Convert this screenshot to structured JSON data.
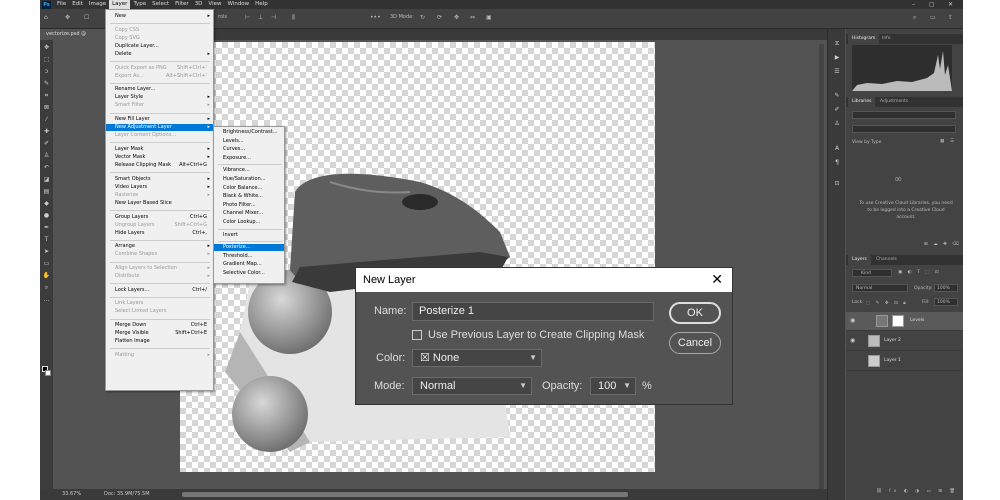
{
  "menubar": {
    "app_icon": "Ps",
    "items": [
      "File",
      "Edit",
      "Image",
      "Layer",
      "Type",
      "Select",
      "Filter",
      "3D",
      "View",
      "Window",
      "Help"
    ],
    "active": "Layer",
    "window_controls": [
      "–",
      "▢",
      "✕"
    ]
  },
  "optionsbar": {
    "transform_label": "rols",
    "mode_label": "3D Mode:"
  },
  "document_tab": {
    "label": "vectorize.psd @"
  },
  "layer_menu": {
    "items": [
      {
        "label": "New",
        "shortcut": "",
        "submenu": true,
        "disabled": false
      },
      {
        "label": "Copy CSS",
        "shortcut": "",
        "submenu": false,
        "disabled": true
      },
      {
        "label": "Copy SVG",
        "shortcut": "",
        "submenu": false,
        "disabled": true
      },
      {
        "label": "Duplicate Layer...",
        "shortcut": "",
        "submenu": false,
        "disabled": false
      },
      {
        "label": "Delete",
        "shortcut": "",
        "submenu": true,
        "disabled": false
      },
      {
        "label": "Quick Export as PNG",
        "shortcut": "Shift+Ctrl+'",
        "submenu": false,
        "disabled": true
      },
      {
        "label": "Export As...",
        "shortcut": "Alt+Shift+Ctrl+'",
        "submenu": false,
        "disabled": true
      },
      {
        "label": "Rename Layer...",
        "shortcut": "",
        "submenu": false,
        "disabled": false
      },
      {
        "label": "Layer Style",
        "shortcut": "",
        "submenu": true,
        "disabled": false
      },
      {
        "label": "Smart Filter",
        "shortcut": "",
        "submenu": true,
        "disabled": true
      },
      {
        "label": "New Fill Layer",
        "shortcut": "",
        "submenu": true,
        "disabled": false
      },
      {
        "label": "New Adjustment Layer",
        "shortcut": "",
        "submenu": true,
        "disabled": false
      },
      {
        "label": "Layer Content Options...",
        "shortcut": "",
        "submenu": false,
        "disabled": true
      },
      {
        "label": "Layer Mask",
        "shortcut": "",
        "submenu": true,
        "disabled": false
      },
      {
        "label": "Vector Mask",
        "shortcut": "",
        "submenu": true,
        "disabled": false
      },
      {
        "label": "Release Clipping Mask",
        "shortcut": "Alt+Ctrl+G",
        "submenu": false,
        "disabled": false
      },
      {
        "label": "Smart Objects",
        "shortcut": "",
        "submenu": true,
        "disabled": false
      },
      {
        "label": "Video Layers",
        "shortcut": "",
        "submenu": true,
        "disabled": false
      },
      {
        "label": "Rasterize",
        "shortcut": "",
        "submenu": true,
        "disabled": true
      },
      {
        "label": "New Layer Based Slice",
        "shortcut": "",
        "submenu": false,
        "disabled": false
      },
      {
        "label": "Group Layers",
        "shortcut": "Ctrl+G",
        "submenu": false,
        "disabled": false
      },
      {
        "label": "Ungroup Layers",
        "shortcut": "Shift+Ctrl+G",
        "submenu": false,
        "disabled": true
      },
      {
        "label": "Hide Layers",
        "shortcut": "Ctrl+,",
        "submenu": false,
        "disabled": false
      },
      {
        "label": "Arrange",
        "shortcut": "",
        "submenu": true,
        "disabled": false
      },
      {
        "label": "Combine Shapes",
        "shortcut": "",
        "submenu": true,
        "disabled": true
      },
      {
        "label": "Align Layers to Selection",
        "shortcut": "",
        "submenu": true,
        "disabled": true
      },
      {
        "label": "Distribute",
        "shortcut": "",
        "submenu": true,
        "disabled": true
      },
      {
        "label": "Lock Layers...",
        "shortcut": "Ctrl+/",
        "submenu": false,
        "disabled": false
      },
      {
        "label": "Link Layers",
        "shortcut": "",
        "submenu": false,
        "disabled": true
      },
      {
        "label": "Select Linked Layers",
        "shortcut": "",
        "submenu": false,
        "disabled": true
      },
      {
        "label": "Merge Down",
        "shortcut": "Ctrl+E",
        "submenu": false,
        "disabled": false
      },
      {
        "label": "Merge Visible",
        "shortcut": "Shift+Ctrl+E",
        "submenu": false,
        "disabled": false
      },
      {
        "label": "Flatten Image",
        "shortcut": "",
        "submenu": false,
        "disabled": false
      },
      {
        "label": "Matting",
        "shortcut": "",
        "submenu": true,
        "disabled": true
      }
    ],
    "highlighted": "New Adjustment Layer"
  },
  "adjustment_submenu": {
    "items": [
      "Brightness/Contrast...",
      "Levels...",
      "Curves...",
      "Exposure...",
      "Vibrance...",
      "Hue/Saturation...",
      "Color Balance...",
      "Black & White...",
      "Photo Filter...",
      "Channel Mixer...",
      "Color Lookup...",
      "Invert",
      "Posterize...",
      "Threshold...",
      "Gradient Map...",
      "Selective Color..."
    ],
    "highlighted": "Posterize..."
  },
  "dialog": {
    "title": "New Layer",
    "close": "✕",
    "name_label": "Name:",
    "name_value": "Posterize 1",
    "clip_label": "Use Previous Layer to Create Clipping Mask",
    "color_label": "Color:",
    "color_value": "None",
    "mode_label": "Mode:",
    "mode_value": "Normal",
    "opacity_label": "Opacity:",
    "opacity_value": "100",
    "opacity_unit": "%",
    "ok_label": "OK",
    "cancel_label": "Cancel"
  },
  "panels": {
    "histogram_tabs": [
      "Histogram",
      "Info"
    ],
    "libraries_tabs": [
      "Libraries",
      "Adjustments"
    ],
    "view_by": "View by Type",
    "cc_message_line1": "To use Creative Cloud Libraries, you need",
    "cc_message_line2": "to be logged into a Creative Cloud",
    "cc_message_line3": "account.",
    "layers_tabs": [
      "Layers",
      "Channels"
    ],
    "kind_label": "Kind",
    "blend_mode": "Normal",
    "opacity_label": "Opacity:",
    "opacity_value": "100%",
    "lock_label": "Lock:",
    "fill_label": "Fill:",
    "fill_value": "100%",
    "layers": [
      {
        "name": "Levels",
        "selected": true
      },
      {
        "name": "Layer 2",
        "selected": false
      },
      {
        "name": "Layer 1",
        "selected": false
      }
    ]
  },
  "status": {
    "zoom": "33.67%",
    "doc": "Doc: 35.9M/75.5M"
  }
}
